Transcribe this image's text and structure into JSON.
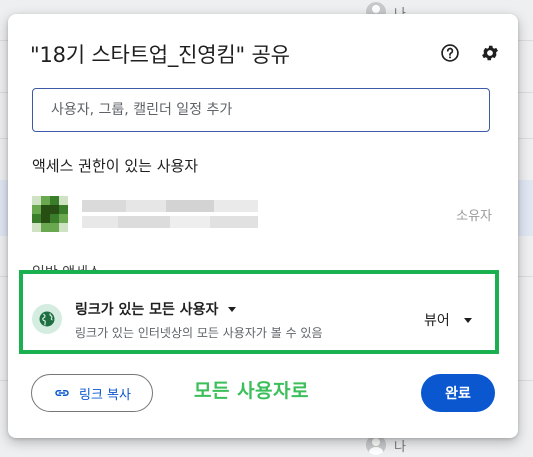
{
  "background": {
    "user_label": "나"
  },
  "dialog": {
    "title": "\"18기 스타트업_진영킴\" 공유",
    "help_icon": "help-circle-icon",
    "settings_icon": "gear-icon",
    "add_people": {
      "placeholder": "사용자, 그룹, 캘린더 일정 추가",
      "value": ""
    },
    "people_section_title": "액세스 권한이 있는 사용자",
    "owner": {
      "role": "소유자",
      "avatar_colors": [
        "#3a7d2a",
        "#6aa84f",
        "#cfe2c4",
        "#274e13"
      ]
    },
    "general_access": {
      "title": "일반 액세스",
      "link_setting": "링크가 있는 모든 사용자",
      "description": "링크가 있는 인터넷상의 모든 사용자가 볼 수 있음",
      "role": "뷰어",
      "highlight_color": "#1bb04f"
    },
    "copy_link_label": "링크 복사",
    "annotation": "모든 사용자로",
    "done_label": "완료",
    "accent_color": "#0b57d0"
  }
}
